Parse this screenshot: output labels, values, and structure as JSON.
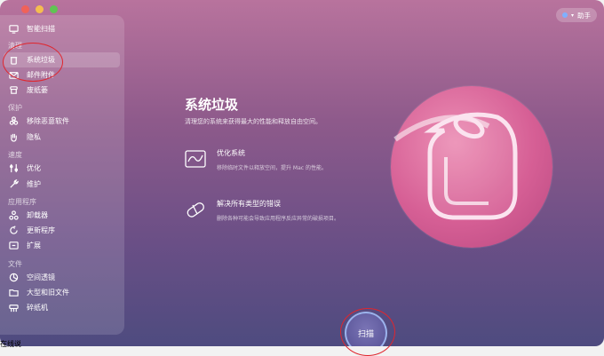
{
  "window": {
    "helper_label": "助手"
  },
  "sidebar": {
    "top_item": {
      "label": "智能扫描",
      "icon": "monitor-icon"
    },
    "sections": [
      {
        "label": "清理"
      },
      {
        "label": "保护"
      },
      {
        "label": "速度"
      },
      {
        "label": "应用程序"
      },
      {
        "label": "文件"
      }
    ],
    "items": [
      {
        "label": "系统垃圾",
        "icon": "trash-icon",
        "active": true
      },
      {
        "label": "邮件附件",
        "icon": "mail-icon"
      },
      {
        "label": "废纸篓",
        "icon": "bin-icon"
      },
      {
        "label": "移除恶意软件",
        "icon": "biohazard-icon"
      },
      {
        "label": "隐私",
        "icon": "hand-icon"
      },
      {
        "label": "优化",
        "icon": "sliders-icon"
      },
      {
        "label": "维护",
        "icon": "wrench-icon"
      },
      {
        "label": "卸载器",
        "icon": "apps-icon"
      },
      {
        "label": "更新程序",
        "icon": "update-icon"
      },
      {
        "label": "扩展",
        "icon": "extension-icon"
      },
      {
        "label": "空间透镜",
        "icon": "lens-icon"
      },
      {
        "label": "大型和旧文件",
        "icon": "folder-icon"
      },
      {
        "label": "碎纸机",
        "icon": "shredder-icon"
      }
    ]
  },
  "main": {
    "title": "系统垃圾",
    "description": "清理您的系统来获得最大的性能和释放自由空间。",
    "features": [
      {
        "title": "优化系统",
        "description": "移除临时文件以释放空间，提升 Mac 的性能。",
        "icon": "chart-icon"
      },
      {
        "title": "解决所有类型的错误",
        "description": "删除各种可能会导致应用程序反应异常的破损项目。",
        "icon": "pill-icon"
      }
    ],
    "scan_label": "扫描"
  },
  "footer": {
    "partial_label": "在线说"
  },
  "colors": {
    "annotation": "#e0262e",
    "hero_pink": "#d65f95"
  }
}
